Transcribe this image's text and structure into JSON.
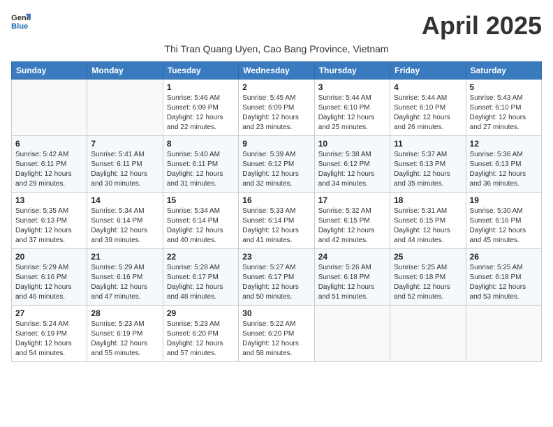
{
  "logo": {
    "line1": "General",
    "line2": "Blue"
  },
  "title": "April 2025",
  "subtitle": "Thi Tran Quang Uyen, Cao Bang Province, Vietnam",
  "days_header": [
    "Sunday",
    "Monday",
    "Tuesday",
    "Wednesday",
    "Thursday",
    "Friday",
    "Saturday"
  ],
  "weeks": [
    [
      {
        "day": "",
        "info": ""
      },
      {
        "day": "",
        "info": ""
      },
      {
        "day": "1",
        "info": "Sunrise: 5:46 AM\nSunset: 6:09 PM\nDaylight: 12 hours and 22 minutes."
      },
      {
        "day": "2",
        "info": "Sunrise: 5:45 AM\nSunset: 6:09 PM\nDaylight: 12 hours and 23 minutes."
      },
      {
        "day": "3",
        "info": "Sunrise: 5:44 AM\nSunset: 6:10 PM\nDaylight: 12 hours and 25 minutes."
      },
      {
        "day": "4",
        "info": "Sunrise: 5:44 AM\nSunset: 6:10 PM\nDaylight: 12 hours and 26 minutes."
      },
      {
        "day": "5",
        "info": "Sunrise: 5:43 AM\nSunset: 6:10 PM\nDaylight: 12 hours and 27 minutes."
      }
    ],
    [
      {
        "day": "6",
        "info": "Sunrise: 5:42 AM\nSunset: 6:11 PM\nDaylight: 12 hours and 29 minutes."
      },
      {
        "day": "7",
        "info": "Sunrise: 5:41 AM\nSunset: 6:11 PM\nDaylight: 12 hours and 30 minutes."
      },
      {
        "day": "8",
        "info": "Sunrise: 5:40 AM\nSunset: 6:11 PM\nDaylight: 12 hours and 31 minutes."
      },
      {
        "day": "9",
        "info": "Sunrise: 5:39 AM\nSunset: 6:12 PM\nDaylight: 12 hours and 32 minutes."
      },
      {
        "day": "10",
        "info": "Sunrise: 5:38 AM\nSunset: 6:12 PM\nDaylight: 12 hours and 34 minutes."
      },
      {
        "day": "11",
        "info": "Sunrise: 5:37 AM\nSunset: 6:13 PM\nDaylight: 12 hours and 35 minutes."
      },
      {
        "day": "12",
        "info": "Sunrise: 5:36 AM\nSunset: 6:13 PM\nDaylight: 12 hours and 36 minutes."
      }
    ],
    [
      {
        "day": "13",
        "info": "Sunrise: 5:35 AM\nSunset: 6:13 PM\nDaylight: 12 hours and 37 minutes."
      },
      {
        "day": "14",
        "info": "Sunrise: 5:34 AM\nSunset: 6:14 PM\nDaylight: 12 hours and 39 minutes."
      },
      {
        "day": "15",
        "info": "Sunrise: 5:34 AM\nSunset: 6:14 PM\nDaylight: 12 hours and 40 minutes."
      },
      {
        "day": "16",
        "info": "Sunrise: 5:33 AM\nSunset: 6:14 PM\nDaylight: 12 hours and 41 minutes."
      },
      {
        "day": "17",
        "info": "Sunrise: 5:32 AM\nSunset: 6:15 PM\nDaylight: 12 hours and 42 minutes."
      },
      {
        "day": "18",
        "info": "Sunrise: 5:31 AM\nSunset: 6:15 PM\nDaylight: 12 hours and 44 minutes."
      },
      {
        "day": "19",
        "info": "Sunrise: 5:30 AM\nSunset: 6:16 PM\nDaylight: 12 hours and 45 minutes."
      }
    ],
    [
      {
        "day": "20",
        "info": "Sunrise: 5:29 AM\nSunset: 6:16 PM\nDaylight: 12 hours and 46 minutes."
      },
      {
        "day": "21",
        "info": "Sunrise: 5:29 AM\nSunset: 6:16 PM\nDaylight: 12 hours and 47 minutes."
      },
      {
        "day": "22",
        "info": "Sunrise: 5:28 AM\nSunset: 6:17 PM\nDaylight: 12 hours and 48 minutes."
      },
      {
        "day": "23",
        "info": "Sunrise: 5:27 AM\nSunset: 6:17 PM\nDaylight: 12 hours and 50 minutes."
      },
      {
        "day": "24",
        "info": "Sunrise: 5:26 AM\nSunset: 6:18 PM\nDaylight: 12 hours and 51 minutes."
      },
      {
        "day": "25",
        "info": "Sunrise: 5:25 AM\nSunset: 6:18 PM\nDaylight: 12 hours and 52 minutes."
      },
      {
        "day": "26",
        "info": "Sunrise: 5:25 AM\nSunset: 6:18 PM\nDaylight: 12 hours and 53 minutes."
      }
    ],
    [
      {
        "day": "27",
        "info": "Sunrise: 5:24 AM\nSunset: 6:19 PM\nDaylight: 12 hours and 54 minutes."
      },
      {
        "day": "28",
        "info": "Sunrise: 5:23 AM\nSunset: 6:19 PM\nDaylight: 12 hours and 55 minutes."
      },
      {
        "day": "29",
        "info": "Sunrise: 5:23 AM\nSunset: 6:20 PM\nDaylight: 12 hours and 57 minutes."
      },
      {
        "day": "30",
        "info": "Sunrise: 5:22 AM\nSunset: 6:20 PM\nDaylight: 12 hours and 58 minutes."
      },
      {
        "day": "",
        "info": ""
      },
      {
        "day": "",
        "info": ""
      },
      {
        "day": "",
        "info": ""
      }
    ]
  ]
}
